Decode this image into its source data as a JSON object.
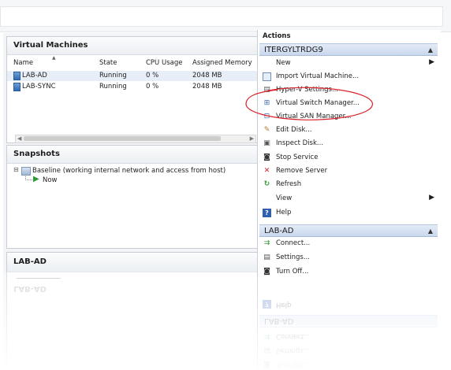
{
  "vm_panel": {
    "title": "Virtual Machines",
    "columns": [
      "Name",
      "State",
      "CPU Usage",
      "Assigned Memory"
    ],
    "rows": [
      {
        "name": "LAB-AD",
        "state": "Running",
        "cpu": "0 %",
        "memory": "2048 MB"
      },
      {
        "name": "LAB-SYNC",
        "state": "Running",
        "cpu": "0 %",
        "memory": "2048 MB"
      }
    ]
  },
  "snapshots_panel": {
    "title": "Snapshots",
    "tree": {
      "root": "Baseline (working internal network and access from host)",
      "child": "Now"
    }
  },
  "details_panel": {
    "title": "LAB-AD"
  },
  "actions": {
    "title": "Actions",
    "host_group": {
      "name": "ITERGYLTRDG9",
      "items": [
        {
          "label": "New",
          "icon": "none",
          "submenu": true
        },
        {
          "label": "Import Virtual Machine...",
          "icon": "import-icon"
        },
        {
          "label": "Hyper-V Settings...",
          "icon": "settings-icon"
        },
        {
          "label": "Virtual Switch Manager...",
          "icon": "switch-icon"
        },
        {
          "label": "Virtual SAN Manager...",
          "icon": "san-icon"
        },
        {
          "label": "Edit Disk...",
          "icon": "edit-disk-icon"
        },
        {
          "label": "Inspect Disk...",
          "icon": "inspect-disk-icon"
        },
        {
          "label": "Stop Service",
          "icon": "stop-icon"
        },
        {
          "label": "Remove Server",
          "icon": "remove-icon"
        },
        {
          "label": "Refresh",
          "icon": "refresh-icon"
        },
        {
          "label": "View",
          "icon": "none",
          "submenu": true
        },
        {
          "label": "Help",
          "icon": "help-icon"
        }
      ]
    },
    "vm_group": {
      "name": "LAB-AD",
      "items": [
        {
          "label": "Connect...",
          "icon": "connect-icon"
        },
        {
          "label": "Settings...",
          "icon": "settings-icon"
        },
        {
          "label": "Turn Off...",
          "icon": "turn-off-icon"
        }
      ]
    }
  },
  "colors": {
    "annotation": "#d9232a",
    "group_header": "#c9d8ee",
    "accent": "#2f6ab3"
  }
}
